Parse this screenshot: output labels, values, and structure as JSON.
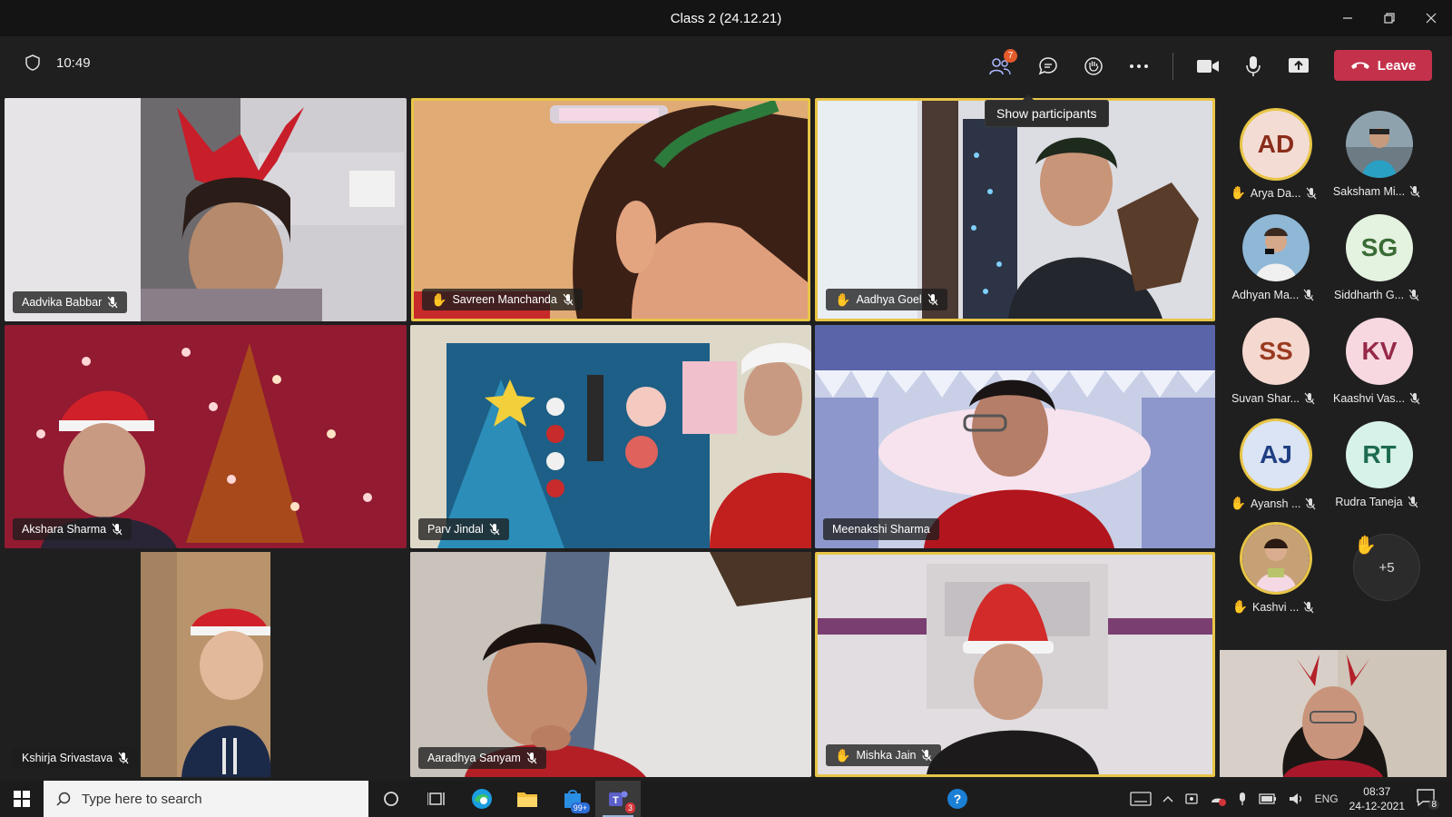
{
  "window": {
    "title": "Class 2 (24.12.21)"
  },
  "toolbar": {
    "time": "10:49",
    "participants_badge": "7",
    "leave_label": "Leave",
    "tooltip": "Show participants"
  },
  "tiles": [
    {
      "name": "Aadvika Babbar",
      "hand": false
    },
    {
      "name": "Savreen Manchanda",
      "hand": true
    },
    {
      "name": "Aadhya Goel",
      "hand": true
    },
    {
      "name": "Akshara Sharma",
      "hand": false
    },
    {
      "name": "Parv Jindal",
      "hand": false
    },
    {
      "name": "Meenakshi Sharma",
      "hand": false
    },
    {
      "name": "Kshirja Srivastava",
      "hand": false
    },
    {
      "name": "Aaradhya Sanyam",
      "hand": false
    },
    {
      "name": "Mishka Jain",
      "hand": true
    }
  ],
  "roster": [
    {
      "initials": "AD",
      "label": "Arya Da...",
      "hand": true,
      "bg": "#f3dcd4",
      "fg": "#8a2c1a"
    },
    {
      "initials": "",
      "label": "Saksham Mi...",
      "hand": false
    },
    {
      "initials": "",
      "label": "Adhyan Ma...",
      "hand": false
    },
    {
      "initials": "SG",
      "label": "Siddharth G...",
      "hand": false,
      "bg": "#e4f2e0",
      "fg": "#3a6b35"
    },
    {
      "initials": "SS",
      "label": "Suvan Shar...",
      "hand": false,
      "bg": "#f5d9d0",
      "fg": "#9a3a20"
    },
    {
      "initials": "KV",
      "label": "Kaashvi Vas...",
      "hand": false,
      "bg": "#f8d8e0",
      "fg": "#962848"
    },
    {
      "initials": "AJ",
      "label": "Ayansh ...",
      "hand": true,
      "bg": "#dbe4f5",
      "fg": "#1f3f82"
    },
    {
      "initials": "RT",
      "label": "Rudra Taneja",
      "hand": false,
      "bg": "#d7f2e8",
      "fg": "#1d6b4e"
    },
    {
      "initials": "",
      "label": "Kashvi ...",
      "hand": true
    }
  ],
  "more_count": "+5",
  "taskbar": {
    "search_placeholder": "Type here to search",
    "edge_badge": "99+",
    "teams_badge": "3",
    "lang": "ENG",
    "time": "08:37",
    "date": "24-12-2021",
    "notif_count": "8"
  }
}
